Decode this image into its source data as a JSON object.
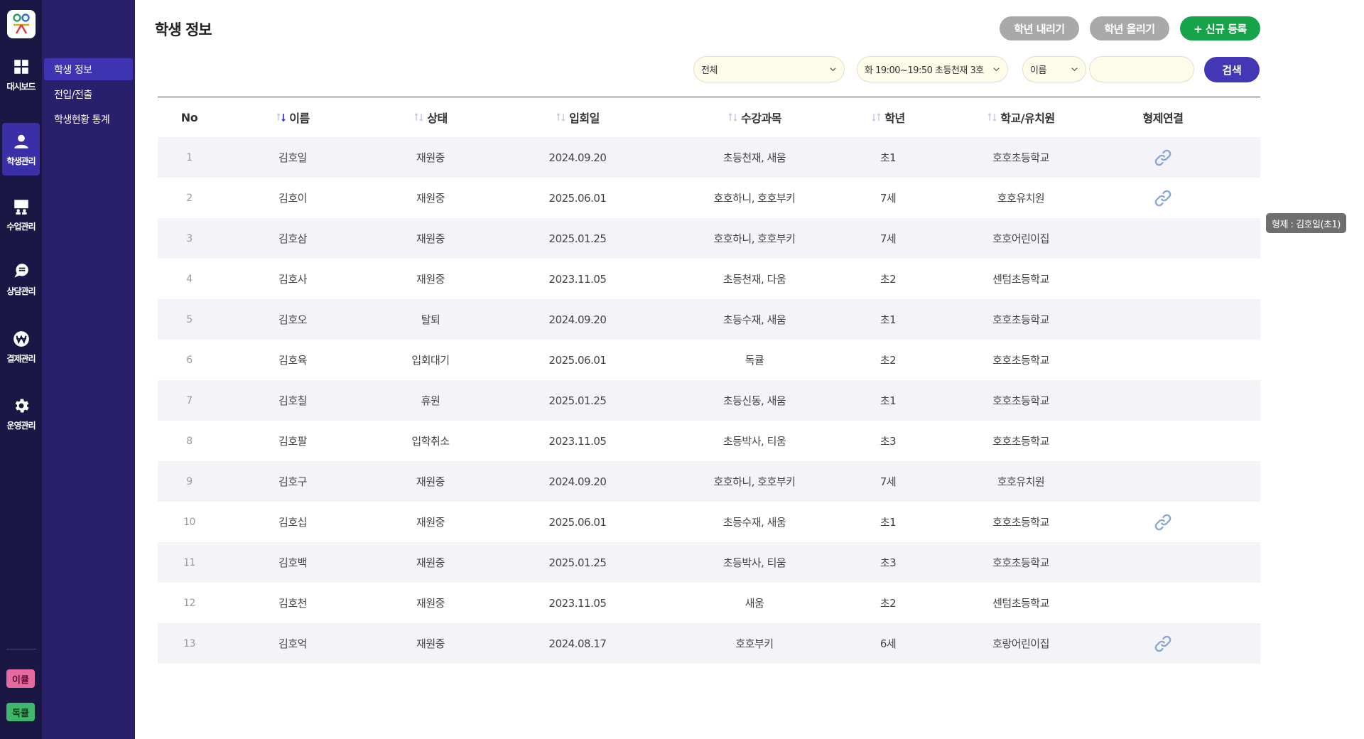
{
  "rail": {
    "items": [
      {
        "label": "대시보드",
        "icon": "dashboard-icon"
      },
      {
        "label": "학생관리",
        "icon": "student-icon"
      },
      {
        "label": "수업관리",
        "icon": "class-icon"
      },
      {
        "label": "상담관리",
        "icon": "chat-icon"
      },
      {
        "label": "결제관리",
        "icon": "won-icon"
      },
      {
        "label": "운영관리",
        "icon": "gear-icon"
      }
    ],
    "active": "학생관리",
    "badges": [
      "이큘",
      "독큘"
    ]
  },
  "submenu": {
    "items": [
      "학생 정보",
      "전입/전출",
      "학생현황 통계"
    ],
    "active": "학생 정보"
  },
  "page": {
    "title": "학생 정보"
  },
  "actions": {
    "grade_down": "학년 내리기",
    "grade_up": "학년 올리기",
    "new_register": "+ 신규 등록"
  },
  "filters": {
    "status": "전체",
    "class": "화 19:00~19:50 초등천재 3호",
    "search_field": "이름",
    "search_value": "",
    "search_button": "검색"
  },
  "table": {
    "columns": [
      "No",
      "이름",
      "상태",
      "입회일",
      "수강과목",
      "학년",
      "학교/유치원",
      "형제연결"
    ],
    "sort_active": "이름",
    "rows": [
      {
        "no": "1",
        "name": "김호일",
        "status": "재원중",
        "date": "2024.09.20",
        "course": "초등천재, 새움",
        "grade": "초1",
        "school": "호호초등학교",
        "sibling": true
      },
      {
        "no": "2",
        "name": "김호이",
        "status": "재원중",
        "date": "2025.06.01",
        "course": "호호하니, 호호부키",
        "grade": "7세",
        "school": "호호유치원",
        "sibling": true
      },
      {
        "no": "3",
        "name": "김호삼",
        "status": "재원중",
        "date": "2025.01.25",
        "course": "호호하니, 호호부키",
        "grade": "7세",
        "school": "호호어린이집",
        "sibling": false
      },
      {
        "no": "4",
        "name": "김호사",
        "status": "재원중",
        "date": "2023.11.05",
        "course": "초등천재, 다움",
        "grade": "초2",
        "school": "센텀초등학교",
        "sibling": false
      },
      {
        "no": "5",
        "name": "김호오",
        "status": "탈퇴",
        "date": "2024.09.20",
        "course": "초등수재, 새움",
        "grade": "초1",
        "school": "호호초등학교",
        "sibling": false
      },
      {
        "no": "6",
        "name": "김호육",
        "status": "입회대기",
        "date": "2025.06.01",
        "course": "독큘",
        "grade": "초2",
        "school": "호호초등학교",
        "sibling": false
      },
      {
        "no": "7",
        "name": "김호칠",
        "status": "휴원",
        "date": "2025.01.25",
        "course": "초등신동, 새움",
        "grade": "초1",
        "school": "호호초등학교",
        "sibling": false
      },
      {
        "no": "8",
        "name": "김호팔",
        "status": "입학취소",
        "date": "2023.11.05",
        "course": "초등박사, 티움",
        "grade": "초3",
        "school": "호호초등학교",
        "sibling": false
      },
      {
        "no": "9",
        "name": "김호구",
        "status": "재원중",
        "date": "2024.09.20",
        "course": "호호하니, 호호부키",
        "grade": "7세",
        "school": "호호유치원",
        "sibling": false
      },
      {
        "no": "10",
        "name": "김호십",
        "status": "재원중",
        "date": "2025.06.01",
        "course": "초등수재, 새움",
        "grade": "초1",
        "school": "호호초등학교",
        "sibling": true
      },
      {
        "no": "11",
        "name": "김호백",
        "status": "재원중",
        "date": "2025.01.25",
        "course": "초등박사, 티움",
        "grade": "초3",
        "school": "호호초등학교",
        "sibling": false
      },
      {
        "no": "12",
        "name": "김호천",
        "status": "재원중",
        "date": "2023.11.05",
        "course": "새움",
        "grade": "초2",
        "school": "센텀초등학교",
        "sibling": false
      },
      {
        "no": "13",
        "name": "김호억",
        "status": "재원중",
        "date": "2024.08.17",
        "course": "호호부키",
        "grade": "6세",
        "school": "호랑어린이집",
        "sibling": true
      }
    ]
  },
  "tooltip": {
    "text": "형제 : 김호일(초1)"
  },
  "colors": {
    "rail_bg": "#1b1744",
    "submenu_bg": "#2a1f6a",
    "active_bg": "#3e33b0",
    "green": "#17a34a",
    "search_purple": "#4437b6",
    "link_blue": "#8aa6d6"
  }
}
